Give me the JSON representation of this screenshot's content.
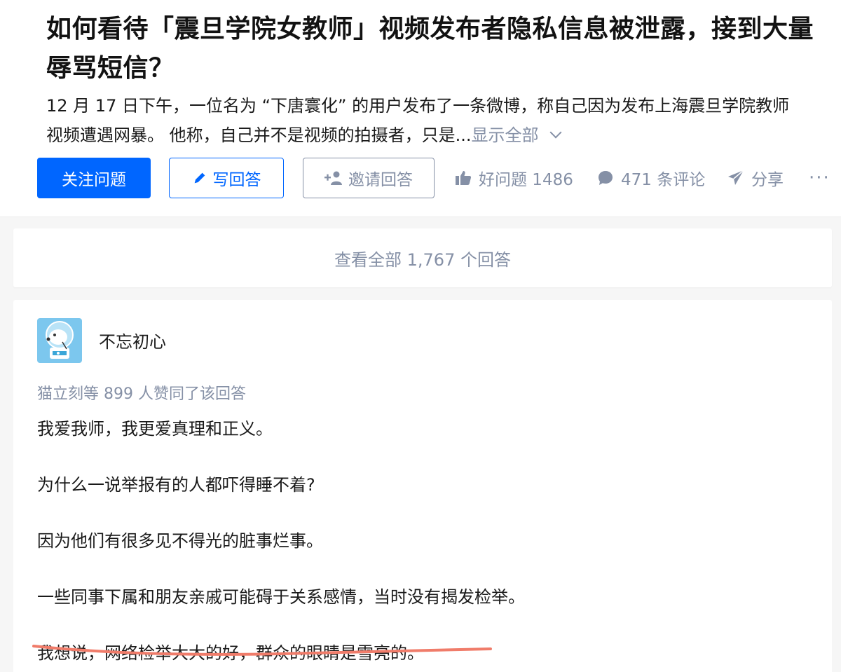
{
  "question": {
    "title": "如何看待「震旦学院女教师」视频发布者隐私信息被泄露，接到大量辱骂短信？",
    "detail_line1": "12 月 17 日下午，一位名为 “下唐寰化” 的用户发布了一条微博，称自己因为发布上海震旦学院教师",
    "detail_line2": "视频遭遇网暴。 他称，自己并不是视频的拍摄者，只是...",
    "show_all": "显示全部"
  },
  "actions": {
    "follow": "关注问题",
    "write_answer": "写回答",
    "invite": "邀请回答",
    "good_question": "好问题 1486",
    "comments": "471 条评论",
    "share": "分享",
    "more": "···"
  },
  "answers_bar": {
    "label": "查看全部 1,767 个回答"
  },
  "answer": {
    "author": "不忘初心",
    "votes": "猫立刻等 899 人赞同了该回答",
    "paragraphs": [
      "我爱我师，我更爱真理和正义。",
      "为什么一说举报有的人都吓得睡不着?",
      "因为他们有很多见不得光的脏事烂事。",
      "一些同事下属和朋友亲戚可能碍于关系感情，当时没有揭发检举。",
      "我想说，网络检举大大的好，群众的眼睛是雪亮的。"
    ]
  },
  "colors": {
    "brand_blue": "#0066ff",
    "meta_gray": "#8590a6",
    "highlight_underline": "#f07c6a"
  },
  "icons": [
    "pencil-icon",
    "add-person-icon",
    "thumbs-up-icon",
    "comment-icon",
    "share-plane-icon",
    "more-dots-icon",
    "chevron-down-icon"
  ]
}
